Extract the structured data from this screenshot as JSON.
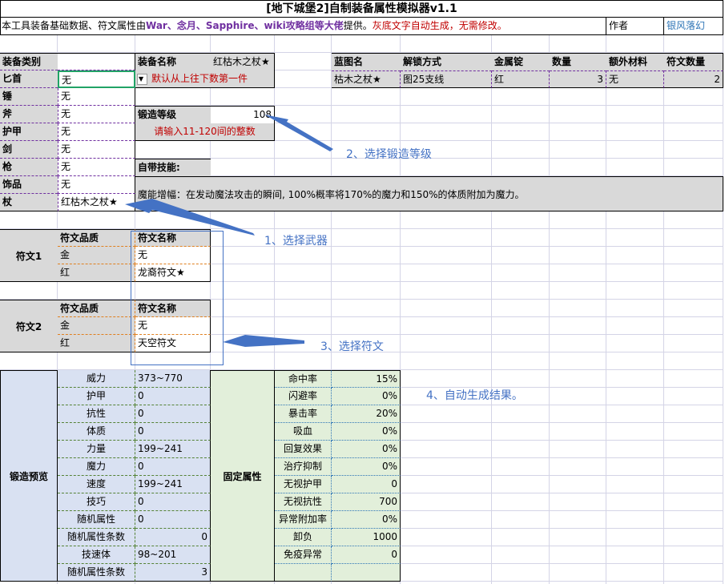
{
  "title": "[地下城堡2]自制装备属性模拟器v1.1",
  "intro": {
    "p1": "本工具装备基础数据、符文属性由",
    "p2": "War、念月、Sapphire、wiki攻略组等大佬",
    "p3": "提供。",
    "p4": "灰底文字自动生成，无需修改。",
    "author_label": "作者",
    "author": "银风落幻"
  },
  "equip": {
    "type_header": "装备类别",
    "name_header": "装备名称",
    "name_value": "红枯木之杖★",
    "hint": "默认从上往下数第一件",
    "types": [
      {
        "label": "匕首",
        "value": "无"
      },
      {
        "label": "锤",
        "value": "无"
      },
      {
        "label": "斧",
        "value": "无"
      },
      {
        "label": "护甲",
        "value": "无"
      },
      {
        "label": "剑",
        "value": "无"
      },
      {
        "label": "枪",
        "value": "无"
      },
      {
        "label": "饰品",
        "value": "无"
      },
      {
        "label": "杖",
        "value": "红枯木之杖★"
      }
    ]
  },
  "blueprint": {
    "headers": [
      "蓝图名",
      "解锁方式",
      "金属锭",
      "数量",
      "额外材料",
      "符文数量"
    ],
    "values": [
      "枯木之杖★",
      "图25支线",
      "红",
      "3",
      "无",
      "2"
    ]
  },
  "forge": {
    "label": "锻造等级",
    "value": "108",
    "hint": "请输入11-120间的整数"
  },
  "skill": {
    "label": "自带技能:",
    "text": "魔能增幅：在发动魔法攻击的瞬间, 100%概率将170%的魔力和150%的体质附加为魔力。"
  },
  "runes": [
    {
      "label": "符文1",
      "quality_header": "符文品质",
      "name_header": "符文名称",
      "rows": [
        {
          "quality": "金",
          "name": "无"
        },
        {
          "quality": "红",
          "name": "龙裔符文★"
        }
      ]
    },
    {
      "label": "符文2",
      "quality_header": "符文品质",
      "name_header": "符文名称",
      "rows": [
        {
          "quality": "金",
          "name": "无"
        },
        {
          "quality": "红",
          "name": "天空符文"
        }
      ]
    }
  ],
  "preview": {
    "label": "锻造预览",
    "rows": [
      {
        "k": "威力",
        "v": "373~770"
      },
      {
        "k": "护甲",
        "v": "0"
      },
      {
        "k": "抗性",
        "v": "0"
      },
      {
        "k": "体质",
        "v": "0"
      },
      {
        "k": "力量",
        "v": "199~241"
      },
      {
        "k": "魔力",
        "v": "0"
      },
      {
        "k": "速度",
        "v": "199~241"
      },
      {
        "k": "技巧",
        "v": "0"
      },
      {
        "k": "随机属性",
        "v": "0"
      },
      {
        "k": "随机属性条数",
        "v": "0",
        "r": true
      },
      {
        "k": "技速体",
        "v": "98~201"
      },
      {
        "k": "随机属性条数",
        "v": "3",
        "r": true
      }
    ]
  },
  "fixed": {
    "label": "固定属性",
    "rows": [
      {
        "k": "命中率",
        "v": "15%"
      },
      {
        "k": "闪避率",
        "v": "0%"
      },
      {
        "k": "暴击率",
        "v": "20%"
      },
      {
        "k": "吸血",
        "v": "0%"
      },
      {
        "k": "回复效果",
        "v": "0%"
      },
      {
        "k": "治疗抑制",
        "v": "0%"
      },
      {
        "k": "无视护甲",
        "v": "0"
      },
      {
        "k": "无视抗性",
        "v": "700"
      },
      {
        "k": "异常附加率",
        "v": "0%"
      },
      {
        "k": "卸负",
        "v": "1000"
      },
      {
        "k": "免疫异常",
        "v": "0"
      }
    ]
  },
  "notes": {
    "n1": "1、选择武器",
    "n2": "2、选择锻造等级",
    "n3": "3、选择符文",
    "n4": "4、自动生成结果。"
  },
  "colors": {
    "note": "#4472c4",
    "purple": "#7030a0",
    "red": "#c00000",
    "select": "#21a366"
  }
}
